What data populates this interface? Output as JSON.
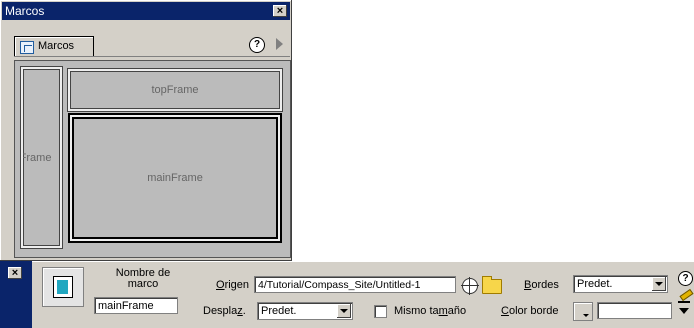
{
  "panel": {
    "title": "Marcos",
    "tab_label": "Marcos",
    "help_label": "?",
    "frames": {
      "left": "leftFrame",
      "top": "topFrame",
      "main": "mainFrame",
      "selected": "mainFrame"
    }
  },
  "properties": {
    "close_label": "x",
    "frame_name_label_line1": "Nombre de",
    "frame_name_label_line2": "marco",
    "frame_name_value": "mainFrame",
    "source_label_pre": "",
    "source_label_u": "O",
    "source_label_post": "rigen",
    "source_value": "4/Tutorial/Compass_Site/Untitled-1",
    "borders_label_u": "B",
    "borders_label_post": "ordes",
    "borders_value": "Predet.",
    "scroll_label_pre": "Despla",
    "scroll_label_u": "z",
    "scroll_label_post": ".",
    "scroll_value": "Predet.",
    "noresize_label_pre": "Mismo ta",
    "noresize_label_u": "m",
    "noresize_label_post": "año",
    "noresize_checked": false,
    "border_color_label_u": "C",
    "border_color_label_post": "olor borde",
    "border_color_value": "",
    "help_label": "?"
  },
  "icons": [
    "close-icon",
    "frames-icon",
    "help-icon",
    "arrow-right-icon",
    "frame-icon",
    "target-icon",
    "folder-icon",
    "dropdown-arrow-icon",
    "edit-icon",
    "collapse-arrow-icon"
  ],
  "colors": {
    "title_bar": "#0a246a",
    "panel_bg": "#d4d0c8",
    "frame_bg": "#bbbbbb"
  }
}
